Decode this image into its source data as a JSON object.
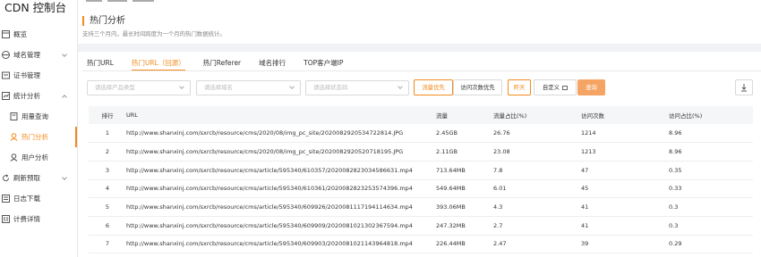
{
  "app_title": "CDN 控制台",
  "sidebar": {
    "items": [
      {
        "label": "概览",
        "icon": "overview-icon"
      },
      {
        "label": "域名管理",
        "icon": "domain-icon"
      },
      {
        "label": "证书管理",
        "icon": "certificate-icon"
      },
      {
        "label": "统计分析",
        "icon": "statistics-icon"
      },
      {
        "label": "用量查询",
        "icon": "usage-query-icon"
      },
      {
        "label": "热门分析",
        "icon": "hot-analysis-icon"
      },
      {
        "label": "用户分析",
        "icon": "user-analysis-icon"
      },
      {
        "label": "刷新预取",
        "icon": "refresh-prefetch-icon"
      },
      {
        "label": "日志下载",
        "icon": "log-download-icon"
      },
      {
        "label": "计费详情",
        "icon": "billing-detail-icon"
      }
    ]
  },
  "page": {
    "title": "热门分析",
    "description": "支持三个月内，最长时间跨度为一个月的热门数据统计。"
  },
  "tabs": [
    "热门URL",
    "热门URL（回源）",
    "热门Referer",
    "域名排行",
    "TOP客户端IP"
  ],
  "filters": {
    "product_type_placeholder": "请选择产品类型",
    "domain_placeholder": "请选择域名",
    "status_code_placeholder": "请选择状态码",
    "traffic_priority": "流量优先",
    "visits_priority": "访问次数优先",
    "yesterday": "昨天",
    "custom": "自定义",
    "query": "查询"
  },
  "table": {
    "headers": [
      "排行",
      "URL",
      "流量",
      "流量占比(%)",
      "访问次数",
      "访问占比(%)"
    ],
    "rows": [
      [
        "1",
        "http://www.shanxinj.com/sxrcb/resource/cms/2020/08/img_pc_site/2020082920534722814.JPG",
        "2.45GB",
        "26.76",
        "1214",
        "8.96"
      ],
      [
        "2",
        "http://www.shanxinj.com/sxrcb/resource/cms/2020/08/img_pc_site/2020082920520718195.JPG",
        "2.11GB",
        "23.08",
        "1213",
        "8.96"
      ],
      [
        "3",
        "http://www.shanxinj.com/sxrcb/resource/cms/article/595340/610357/2020082823034586631.mp4",
        "713.64MB",
        "7.8",
        "47",
        "0.35"
      ],
      [
        "4",
        "http://www.shanxinj.com/sxrcb/resource/cms/article/595340/610361/2020082823253574396.mp4",
        "549.64MB",
        "6.01",
        "45",
        "0.33"
      ],
      [
        "5",
        "http://www.shanxinj.com/sxrcb/resource/cms/article/595340/609926/2020081117194114634.mp4",
        "393.06MB",
        "4.3",
        "41",
        "0.3"
      ],
      [
        "6",
        "http://www.shanxinj.com/sxrcb/resource/cms/article/595340/609909/2020081021302367594.mp4",
        "247.32MB",
        "2.7",
        "41",
        "0.3"
      ],
      [
        "7",
        "http://www.shanxinj.com/sxrcb/resource/cms/article/595340/609903/2020081021143964818.mp4",
        "226.44MB",
        "2.47",
        "39",
        "0.29"
      ]
    ]
  },
  "colors": {
    "accent": "#f28b1c",
    "query_button": "#f5a464"
  }
}
